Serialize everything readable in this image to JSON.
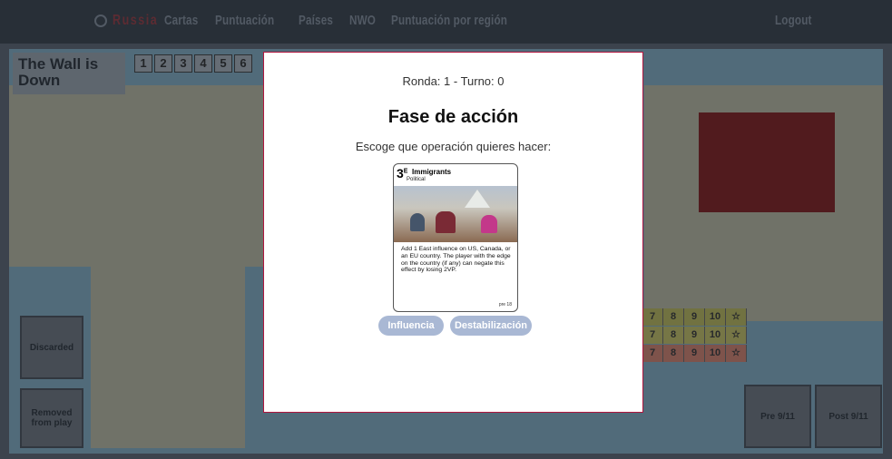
{
  "navbar": {
    "brand": "Russia",
    "links": [
      "Cartas",
      "Puntuación",
      "Países",
      "NWO",
      "Puntuación por región"
    ],
    "logout": "Logout"
  },
  "board": {
    "title": "The Wall is Down",
    "round_track": [
      "1",
      "2",
      "3",
      "4",
      "5",
      "6"
    ],
    "discarded": "Discarded",
    "removed": "Removed from play",
    "pre": "Pre 9/11",
    "post": "Post 9/11",
    "score_rows": [
      [
        "7",
        "8",
        "9",
        "10",
        "☆"
      ],
      [
        "7",
        "8",
        "9",
        "10",
        "☆"
      ],
      [
        "7",
        "8",
        "9",
        "10",
        "☆"
      ]
    ]
  },
  "modal": {
    "round_info": "Ronda: 1 - Turno: 0",
    "phase_title": "Fase de acción",
    "prompt": "Escoge que operación quieres hacer:",
    "card": {
      "ops": "3",
      "ops_sup": "E",
      "title": "Immigrants",
      "type": "Political",
      "text": "Add 1 East influence on US, Canada, or an EU country. The player with the edge on the country (if any) can negate this effect by losing 2VP.",
      "footer": "pre 18"
    },
    "buttons": {
      "influence": "Influencia",
      "destabilize": "Destabilización"
    }
  }
}
